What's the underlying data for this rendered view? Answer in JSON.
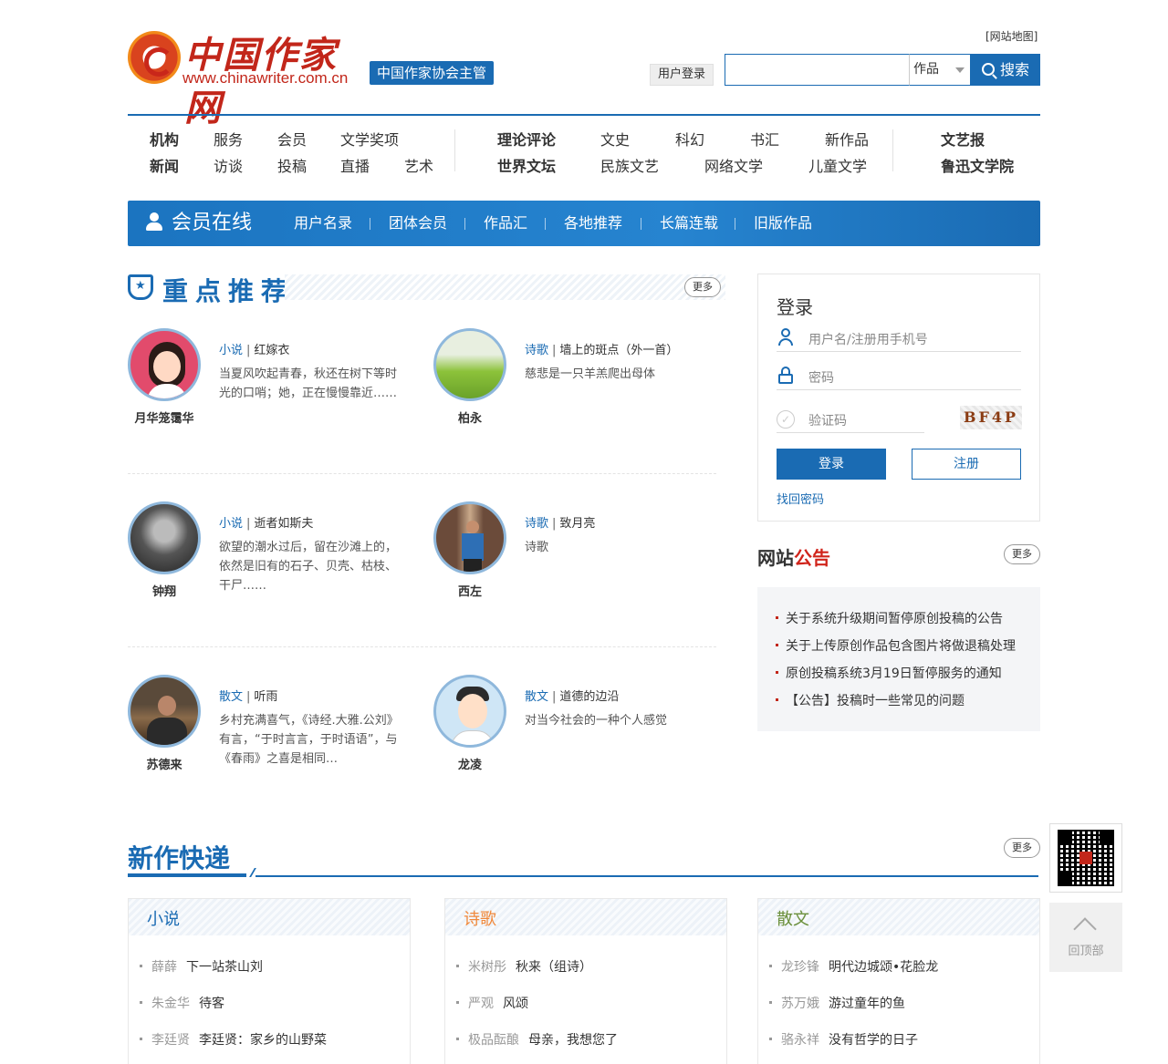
{
  "header": {
    "logo_title": "中国作家网",
    "logo_url": "www.chinawriter.com.cn",
    "sponsor": "中国作家协会主管",
    "sitemap": "[网站地图]",
    "login_tab": "用户登录",
    "search_select": "作品",
    "search_button": "搜索"
  },
  "nav": {
    "group1_row1": [
      "机构",
      "服务",
      "会员",
      "文学奖项"
    ],
    "group1_row2": [
      "新闻",
      "访谈",
      "投稿",
      "直播",
      "艺术"
    ],
    "group2_row1": [
      "理论评论",
      "文史",
      "科幻",
      "书汇",
      "新作品"
    ],
    "group2_row2": [
      "世界文坛",
      "民族文艺",
      "网络文学",
      "儿童文学"
    ],
    "group3": [
      "文艺报",
      "鲁迅文学院"
    ]
  },
  "member_bar": {
    "title": "会员在线",
    "links": [
      "用户名录",
      "团体会员",
      "作品汇",
      "各地推荐",
      "长篇连载",
      "旧版作品"
    ]
  },
  "recommend": {
    "title": "重点推荐",
    "more": "更多",
    "items": [
      {
        "author": "月华笼霭华",
        "category": "小说",
        "title": "红嫁衣",
        "desc": "当夏风吹起青春，秋还在树下等时光的口哨；她，正在慢慢靠近……"
      },
      {
        "author": "柏永",
        "category": "诗歌",
        "title": "墙上的斑点（外一首）",
        "desc": "慈悲是一只羊羔爬出母体"
      },
      {
        "author": "钟翔",
        "category": "小说",
        "title": "逝者如斯夫",
        "desc": "欲望的潮水过后，留在沙滩上的，依然是旧有的石子、贝壳、枯枝、干尸……"
      },
      {
        "author": "西左",
        "category": "诗歌",
        "title": "致月亮",
        "desc": "诗歌"
      },
      {
        "author": "苏德来",
        "category": "散文",
        "title": "听雨",
        "desc": "乡村充满喜气，《诗经.大雅.公刘》有言，“于时言言，于时语语”，与《春雨》之喜是相同…"
      },
      {
        "author": "龙凌",
        "category": "散文",
        "title": "道德的边沿",
        "desc": "对当今社会的一种个人感觉"
      }
    ]
  },
  "login": {
    "heading": "登录",
    "username_placeholder": "用户名/注册用手机号",
    "password_placeholder": "密码",
    "captcha_placeholder": "验证码",
    "captcha_code": "BF4P",
    "login_button": "登录",
    "register_button": "注册",
    "forgot": "找回密码"
  },
  "notice": {
    "title_a": "网站",
    "title_b": "公告",
    "more": "更多",
    "items": [
      "关于系统升级期间暂停原创投稿的公告",
      "关于上传原创作品包含图片将做退稿处理",
      "原创投稿系统3月19日暂停服务的通知",
      "【公告】投稿时一些常见的问题"
    ]
  },
  "new_works": {
    "title": "新作快递",
    "more": "更多",
    "columns": [
      {
        "name": "小说",
        "color": "#1a6bb3",
        "items": [
          {
            "author": "薛薛",
            "work": "下一站茶山刘"
          },
          {
            "author": "朱金华",
            "work": "待客"
          },
          {
            "author": "李廷贤",
            "work": "李廷贤：家乡的山野菜"
          }
        ]
      },
      {
        "name": "诗歌",
        "color": "#f0883a",
        "items": [
          {
            "author": "米树彤",
            "work": "秋来（组诗）"
          },
          {
            "author": "严观",
            "work": "风颂"
          },
          {
            "author": "极品酝酿",
            "work": "母亲，我想您了"
          }
        ]
      },
      {
        "name": "散文",
        "color": "#6a8f3a",
        "items": [
          {
            "author": "龙珍锋",
            "work": "明代边城颂•花脸龙"
          },
          {
            "author": "苏万娥",
            "work": "游过童年的鱼"
          },
          {
            "author": "骆永祥",
            "work": "没有哲学的日子"
          }
        ]
      }
    ]
  },
  "side": {
    "back_to_top": "回顶部"
  }
}
